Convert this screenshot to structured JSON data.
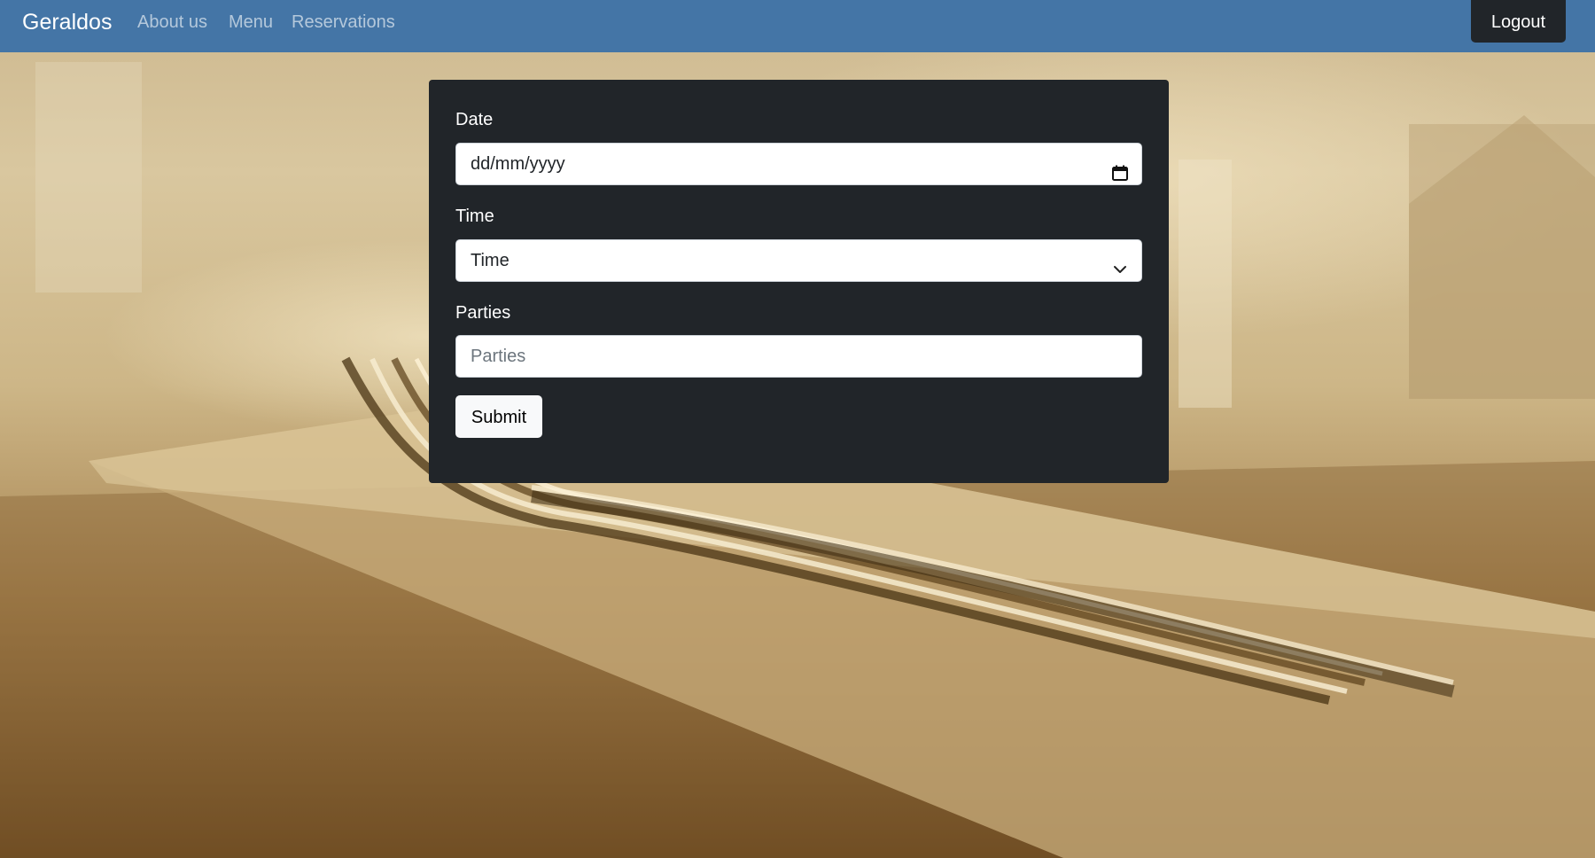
{
  "navbar": {
    "brand": "Geraldos",
    "links": [
      "About us",
      "Menu",
      "Reservations"
    ],
    "logout_label": "Logout",
    "background_color": "#4475a6"
  },
  "form": {
    "date": {
      "label": "Date",
      "value": "dd/mm/yyyy",
      "icon": "calendar-icon"
    },
    "time": {
      "label": "Time",
      "value": "Time",
      "icon": "chevron-down-icon"
    },
    "parties": {
      "label": "Parties",
      "placeholder": "Parties"
    },
    "submit_label": "Submit",
    "card_color": "#212529"
  }
}
